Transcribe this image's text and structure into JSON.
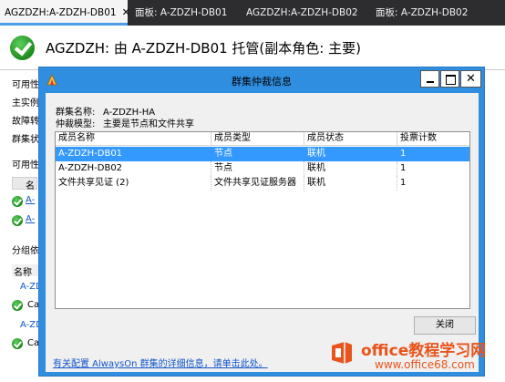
{
  "tabs": [
    {
      "label": "AGZDZH:A-ZDZH-DB01",
      "close": "✕",
      "active": true
    },
    {
      "label": "面板: A-ZDZH-DB01",
      "active": false
    },
    {
      "label": "AGZDZH:A-ZDZH-DB02",
      "active": false
    },
    {
      "label": "面板: A-ZDZH-DB02",
      "active": false
    }
  ],
  "dashboard": {
    "title": "AGZDZH: 由 A-ZDZH-DB01 托管(副本角色: 主要)",
    "labels": [
      "可用性",
      "主实例",
      "故障转",
      "群集状",
      "可用性",
      "名",
      "分组依",
      "名称"
    ],
    "links": [
      "A-",
      "A-"
    ],
    "items": [
      "A-ZDZH",
      "Ca",
      "A-ZDZH",
      "Ca"
    ]
  },
  "dialog": {
    "title": "群集仲裁信息",
    "cluster_name_label": "群集名称:",
    "cluster_name_value": "A-ZDZH-HA",
    "quorum_label": "仲裁模型:",
    "quorum_value": "主要是节点和文件共享",
    "columns": [
      "成员名称",
      "成员类型",
      "成员状态",
      "投票计数"
    ],
    "rows": [
      {
        "name": "A-ZDZH-DB01",
        "type": "节点",
        "state": "联机",
        "votes": "1",
        "selected": true
      },
      {
        "name": "A-ZDZH-DB02",
        "type": "节点",
        "state": "联机",
        "votes": "1",
        "selected": false
      },
      {
        "name": "文件共享见证 (2)",
        "type": "文件共享见证服务器",
        "state": "联机",
        "votes": "1",
        "selected": false
      }
    ],
    "close_button": "关闭",
    "help_link": "有关配置 AlwaysOn 群集的详细信息，请单击此处。"
  },
  "watermark": {
    "text": "office教程学习网",
    "url": "www.office68.com"
  },
  "colors": {
    "selection": "#3399ff",
    "titlebar": "#2f8ee0",
    "tabstrip": "#2d2d30",
    "watermark": "#e8541c"
  }
}
